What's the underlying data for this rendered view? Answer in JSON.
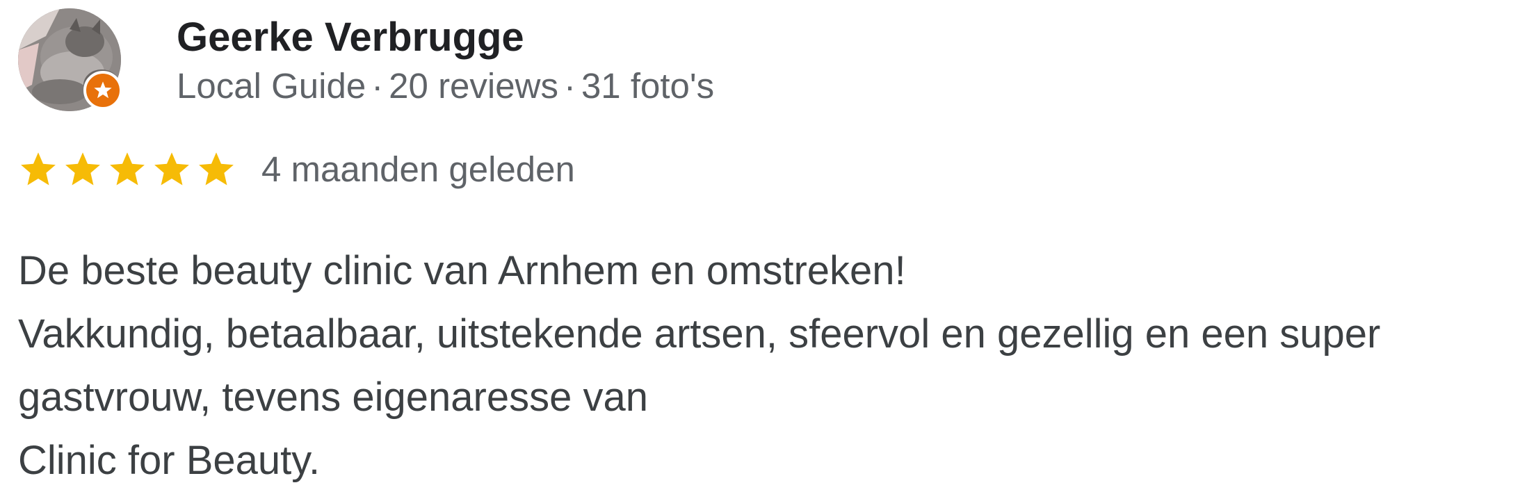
{
  "review": {
    "author": {
      "name": "Geerke Verbrugge",
      "guide_label": "Local Guide",
      "separator": "·",
      "reviews_count": "20 reviews",
      "photos_count": "31 foto's",
      "avatar_icon": "cat-photo-avatar",
      "badge_icon": "local-guide-star-icon"
    },
    "rating": {
      "stars": 5,
      "max": 5,
      "time_ago": "4 maanden geleden"
    },
    "text_lines": [
      "De beste beauty clinic van Arnhem en omstreken!",
      "Vakkundig, betaalbaar, uitstekende artsen, sfeervol en gezellig en een super",
      "gastvrouw, tevens eigenaresse van",
      "Clinic for Beauty."
    ],
    "colors": {
      "star": "#f6bb06",
      "badge": "#e8710a",
      "name": "#202124",
      "meta": "#5f6368",
      "body": "#3c4043"
    }
  }
}
